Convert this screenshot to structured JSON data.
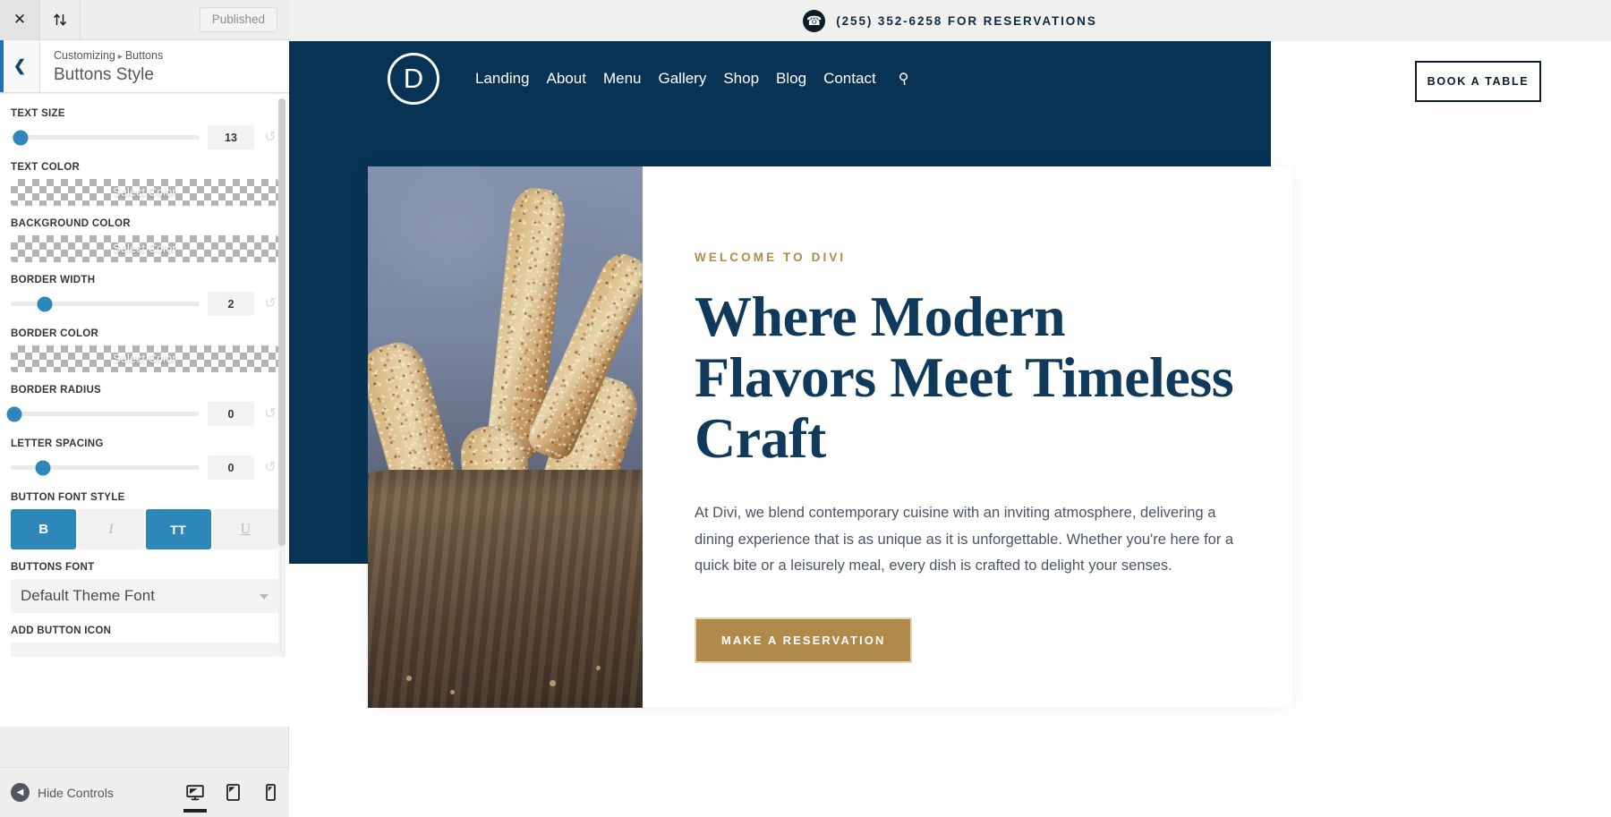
{
  "customizer": {
    "toolbar": {
      "close_icon": "close-icon",
      "devices_icon": "sync-arrows-icon",
      "published_label": "Published"
    },
    "header": {
      "back_icon": "chevron-left-icon",
      "breadcrumb_root": "Customizing",
      "breadcrumb_sep": "▸",
      "breadcrumb_current": "Buttons",
      "panel_title": "Buttons Style"
    },
    "controls": [
      {
        "type": "slider",
        "label": "TEXT SIZE",
        "value": "13",
        "knob_pct": 5,
        "reset_icon": "reset-icon"
      },
      {
        "type": "color",
        "label": "TEXT COLOR",
        "button_label": "Select Color"
      },
      {
        "type": "color",
        "label": "BACKGROUND COLOR",
        "button_label": "Select Color"
      },
      {
        "type": "slider",
        "label": "BORDER WIDTH",
        "value": "2",
        "knob_pct": 18,
        "reset_icon": "reset-icon"
      },
      {
        "type": "color",
        "label": "BORDER COLOR",
        "button_label": "Select Color"
      },
      {
        "type": "slider",
        "label": "BORDER RADIUS",
        "value": "0",
        "knob_pct": 2,
        "reset_icon": "reset-icon"
      },
      {
        "type": "slider",
        "label": "LETTER SPACING",
        "value": "0",
        "knob_pct": 17,
        "reset_icon": "reset-icon"
      }
    ],
    "font_style": {
      "label": "BUTTON FONT STYLE",
      "options": [
        {
          "name": "bold-toggle",
          "glyph": "B",
          "active": true
        },
        {
          "name": "italic-toggle",
          "glyph": "I",
          "active": false
        },
        {
          "name": "uppercase-toggle",
          "glyph": "TT",
          "active": true
        },
        {
          "name": "underline-toggle",
          "glyph": "U",
          "active": false
        }
      ]
    },
    "buttons_font": {
      "label": "BUTTONS FONT",
      "selected": "Default Theme Font",
      "arrow_icon": "chevron-down-icon"
    },
    "add_button_icon": {
      "label": "ADD BUTTON ICON"
    },
    "footer": {
      "hide_controls_label": "Hide Controls",
      "hide_icon": "collapse-left-icon",
      "devices": [
        {
          "name": "desktop",
          "icon": "desktop-icon",
          "active": true
        },
        {
          "name": "tablet",
          "icon": "tablet-icon",
          "active": false
        },
        {
          "name": "mobile",
          "icon": "mobile-icon",
          "active": false
        }
      ]
    },
    "accent_color": "#2e87b9"
  },
  "preview": {
    "topbar": {
      "phone_icon": "phone-icon",
      "phone_text": "(255) 352-6258 FOR RESERVATIONS"
    },
    "nav": {
      "logo_letter": "D",
      "items": [
        {
          "label": "Landing"
        },
        {
          "label": "About"
        },
        {
          "label": "Menu"
        },
        {
          "label": "Gallery"
        },
        {
          "label": "Shop"
        },
        {
          "label": "Blog"
        },
        {
          "label": "Contact"
        }
      ],
      "search_icon": "search-icon",
      "cta_label": "BOOK A TABLE"
    },
    "hero": {
      "image_alt": "seeded-breadsticks-in-paper-bag",
      "eyebrow": "WELCOME TO DIVI",
      "heading": "Where Modern Flavors Meet Timeless Craft",
      "paragraph": "At Divi, we blend contemporary cuisine with an inviting atmosphere, delivering a dining experience that is as unique as it is unforgettable. Whether you're here for a quick bite or a leisurely meal, every dish is crafted to delight your senses.",
      "cta_label": "MAKE A RESERVATION"
    },
    "colors": {
      "navy": "#093355",
      "gold": "#b08a4a",
      "heading_blue": "#0f3a5c"
    }
  }
}
